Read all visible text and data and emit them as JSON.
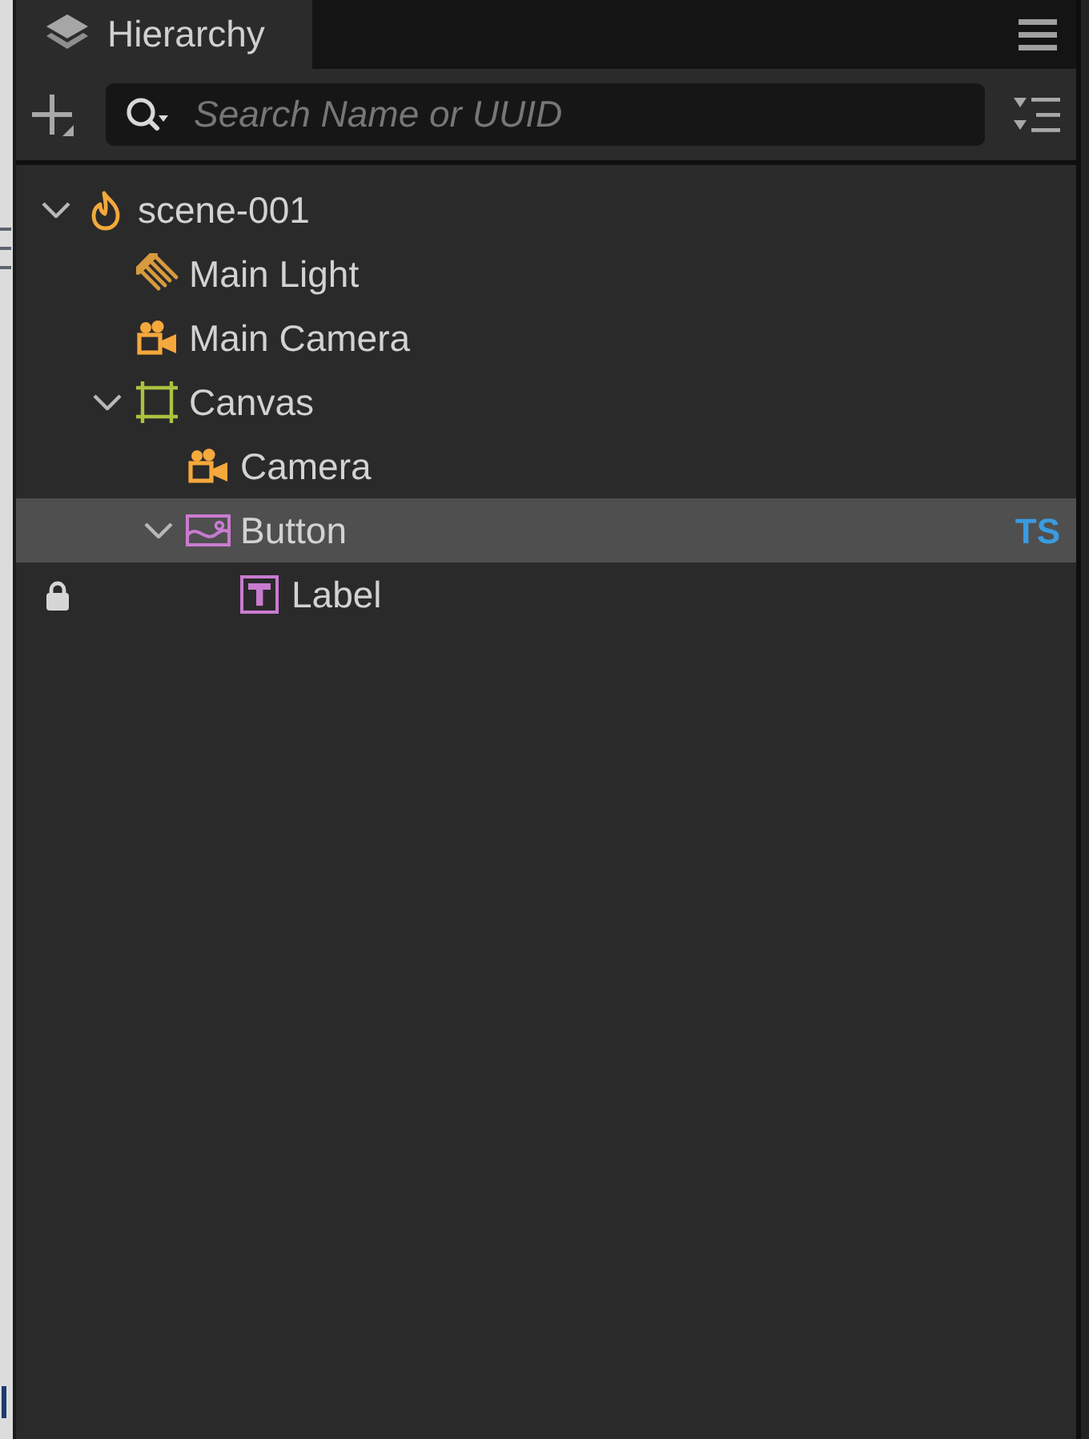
{
  "tab": {
    "title": "Hierarchy",
    "selected": true
  },
  "toolbar": {
    "search": {
      "placeholder": "Search Name or UUID"
    }
  },
  "tree": [
    {
      "label": "scene-001",
      "kind": "scene",
      "expanded": true,
      "selected": false,
      "locked": false,
      "children": [
        {
          "label": "Main Light",
          "kind": "light",
          "selected": false,
          "locked": false
        },
        {
          "label": "Main Camera",
          "kind": "camera",
          "selected": false,
          "locked": false
        },
        {
          "label": "Canvas",
          "kind": "canvas",
          "expanded": true,
          "selected": false,
          "locked": false,
          "children": [
            {
              "label": "Camera",
              "kind": "camera",
              "selected": false,
              "locked": false
            },
            {
              "label": "Button",
              "kind": "button",
              "expanded": true,
              "selected": true,
              "locked": false,
              "badge": "TS",
              "children": [
                {
                  "label": "Label",
                  "kind": "label",
                  "selected": false,
                  "locked": true
                }
              ]
            }
          ]
        }
      ]
    }
  ]
}
